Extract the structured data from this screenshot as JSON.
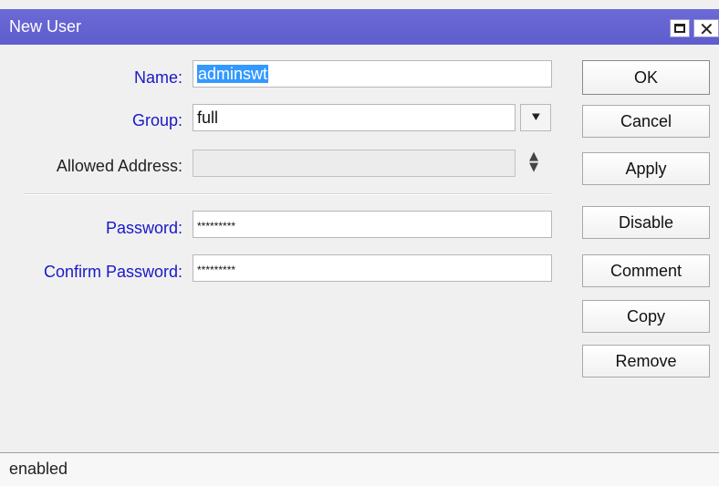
{
  "window": {
    "title": "New User",
    "titlebar_color": "#6463d3",
    "controls": {
      "maximize_icon": "maximize-icon",
      "close_icon": "close-icon",
      "close_glyph": "✕"
    }
  },
  "form": {
    "name": {
      "label": "Name:",
      "value": "adminswt",
      "selected": true
    },
    "group": {
      "label": "Group:",
      "value": "full",
      "dropdown_icon": "dropdown-arrow-icon",
      "dropdown_glyph": "⯆"
    },
    "allowed_address": {
      "label": "Allowed Address:",
      "value": "",
      "spinner_up": "▲",
      "spinner_down": "▼"
    },
    "password": {
      "label": "Password:",
      "value": "*********"
    },
    "confirm_password": {
      "label": "Confirm Password:",
      "value": "*********"
    }
  },
  "buttons": {
    "ok": "OK",
    "cancel": "Cancel",
    "apply": "Apply",
    "disable": "Disable",
    "comment": "Comment",
    "copy": "Copy",
    "remove": "Remove"
  },
  "status": {
    "text": "enabled"
  },
  "colors": {
    "label_blue": "#1818c8",
    "selection": "#3399ff"
  }
}
